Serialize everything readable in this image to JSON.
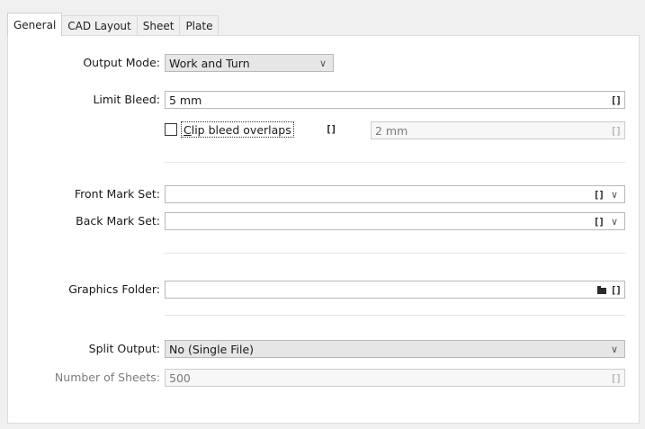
{
  "tabs": [
    {
      "label": "General"
    },
    {
      "label": "CAD Layout"
    },
    {
      "label": "Sheet"
    },
    {
      "label": "Plate"
    }
  ],
  "output_mode": {
    "label": "Output Mode:",
    "value": "Work and Turn"
  },
  "limit_bleed": {
    "label": "Limit Bleed:",
    "value": "5 mm"
  },
  "clip_bleed": {
    "first_letter": "C",
    "rest": "lip bleed overlaps",
    "checked": false,
    "value": "2 mm"
  },
  "front_mark_set": {
    "label": "Front Mark Set:",
    "value": ""
  },
  "back_mark_set": {
    "label": "Back Mark Set:",
    "value": ""
  },
  "graphics_folder": {
    "label": "Graphics Folder:",
    "value": ""
  },
  "split_output": {
    "label": "Split Output:",
    "value": "No (Single File)"
  },
  "number_of_sheets": {
    "label": "Number of Sheets:",
    "value": "500"
  },
  "icons": {
    "bracket": "[]",
    "chevron": "∨",
    "folder": "folder-icon"
  }
}
